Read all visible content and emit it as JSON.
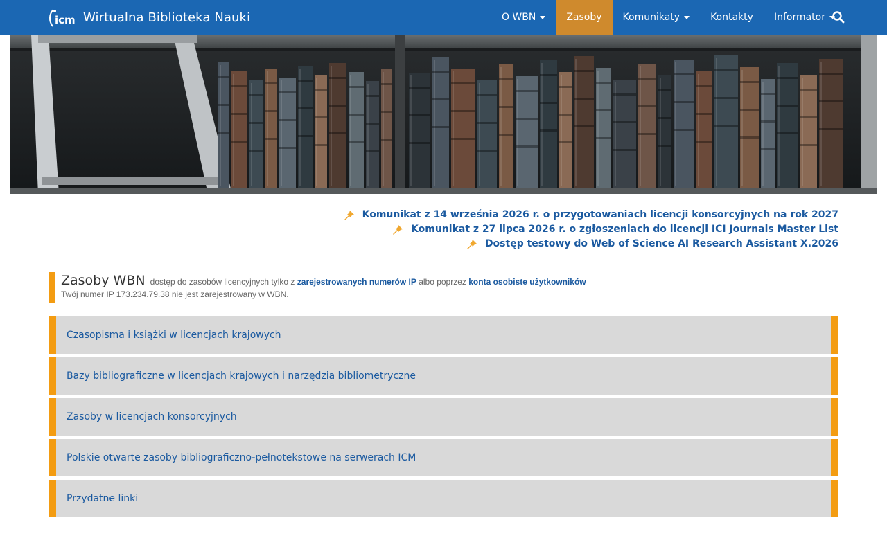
{
  "navbar": {
    "brand_name": "Wirtualna Biblioteka Nauki",
    "logo_text": "icm",
    "items": [
      {
        "label": "O WBN",
        "dropdown": true,
        "active": false
      },
      {
        "label": "Zasoby",
        "dropdown": false,
        "active": true
      },
      {
        "label": "Komunikaty",
        "dropdown": true,
        "active": false
      },
      {
        "label": "Kontakty",
        "dropdown": false,
        "active": false
      },
      {
        "label": "Informator",
        "dropdown": true,
        "active": false
      }
    ],
    "search_icon": "search-icon",
    "colors": {
      "bar": "#1b67b3",
      "active": "#cf8a2d"
    }
  },
  "announcements": [
    {
      "text": "Komunikat z 14 września 2026 r. o przygotowaniach licencji konsorcyjnych na rok 2027",
      "icon": "pin-icon"
    },
    {
      "text": "Komunikat z 27 lipca 2026 r. o zgłoszeniach do licencji ICI Journals Master List",
      "icon": "pin-icon"
    },
    {
      "text": "Dostęp testowy do Web of Science AI Research Assistant X.2026",
      "icon": "pin-icon"
    }
  ],
  "section": {
    "title": "Zasoby WBN",
    "desc_prefix": "dostęp do zasobów licencyjnych tylko z",
    "link_ip": "zarejestrowanych numerów IP",
    "desc_mid": "albo poprzez",
    "link_accounts": "konta osobiste użytkowników",
    "ip_notice": "Twój numer IP 173.234.79.38 nie jest zarejestrowany w WBN."
  },
  "panels": [
    {
      "label": "Czasopisma i książki w licencjach krajowych"
    },
    {
      "label": "Bazy bibliograficzne w licencjach krajowych i narzędzia bibliometryczne"
    },
    {
      "label": "Zasoby w licencjach konsorcyjnych"
    },
    {
      "label": "Polskie otwarte zasoby bibliograficzno-pełnotekstowe na serwerach ICM"
    },
    {
      "label": "Przydatne linki"
    }
  ],
  "accent_color": "#f39c12",
  "link_color": "#1b5aa0"
}
